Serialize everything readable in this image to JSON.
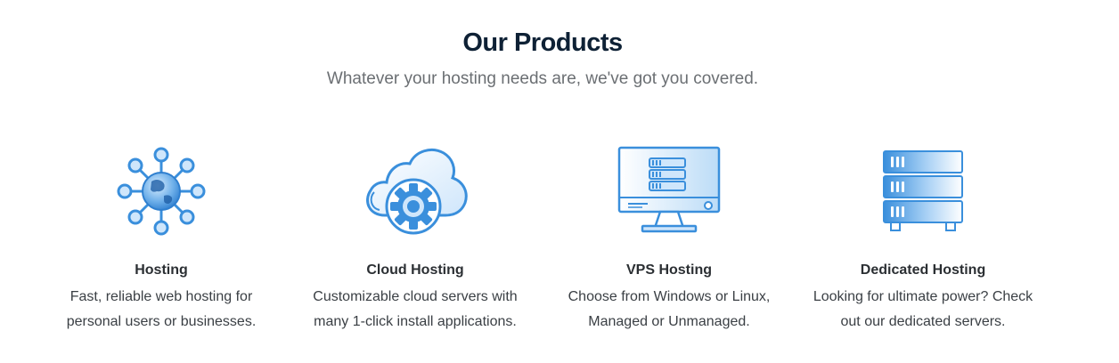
{
  "header": {
    "title": "Our Products",
    "subtitle": "Whatever your hosting needs are, we've got you covered."
  },
  "products": [
    {
      "title": "Hosting",
      "desc_line1": "Fast, reliable web hosting for",
      "desc_line2": "personal users or businesses.",
      "icon": "globe-network-icon"
    },
    {
      "title": "Cloud Hosting",
      "desc_line1": "Customizable cloud servers with",
      "desc_line2": "many 1-click install applications.",
      "icon": "cloud-gear-icon"
    },
    {
      "title": "VPS Hosting",
      "desc_line1": "Choose from Windows or Linux,",
      "desc_line2": "Managed or Unmanaged.",
      "icon": "monitor-server-icon"
    },
    {
      "title": "Dedicated Hosting",
      "desc_line1": "Looking for ultimate power? Check",
      "desc_line2": "out our dedicated servers.",
      "icon": "server-rack-icon"
    }
  ],
  "colors": {
    "primary_blue": "#3a8fdc",
    "light_blue": "#cfe6fb",
    "title": "#0e2135",
    "subtitle": "#6b6f73"
  }
}
